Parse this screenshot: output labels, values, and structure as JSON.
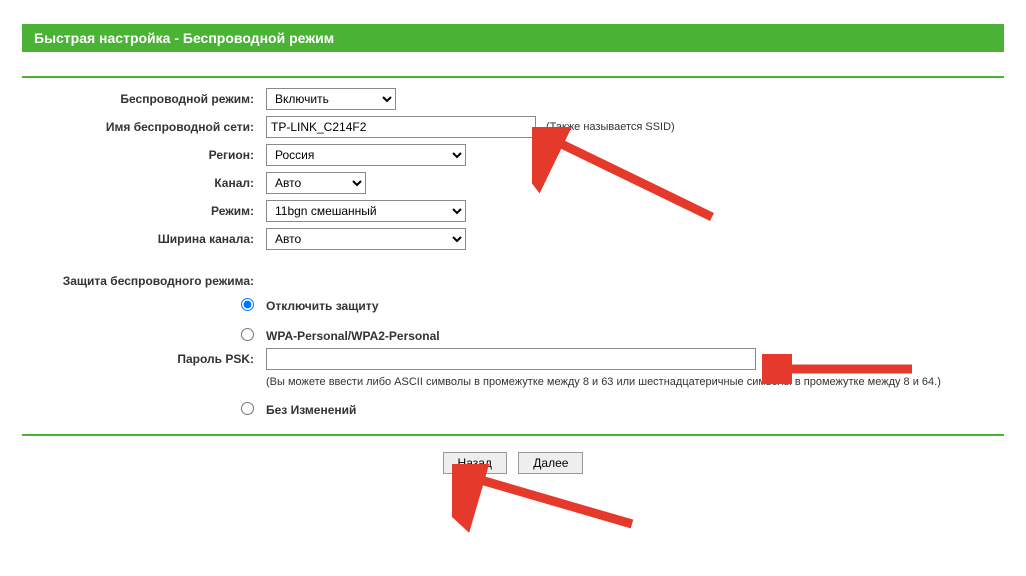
{
  "title": "Быстрая настройка - Беспроводной режим",
  "labels": {
    "wireless_mode": "Беспроводной режим:",
    "ssid": "Имя беспроводной сети:",
    "region": "Регион:",
    "channel": "Канал:",
    "mode": "Режим:",
    "channel_width": "Ширина канала:",
    "security": "Защита беспроводного режима:",
    "psk_password": "Пароль PSK:"
  },
  "values": {
    "wireless_mode": "Включить",
    "ssid": "TP-LINK_C214F2",
    "region": "Россия",
    "channel": "Авто",
    "mode": "11bgn смешанный",
    "channel_width": "Авто",
    "psk_password": ""
  },
  "hints": {
    "ssid_suffix": "(Также называется SSID)",
    "psk_note": "(Вы можете ввести либо ASCII символы в промежутке между 8 и 63 или шестнадцатеричные символы в промежутке между 8 и 64.)"
  },
  "security_options": {
    "disable": "Отключить защиту",
    "wpa": "WPA-Personal/WPA2-Personal",
    "nochange": "Без Изменений"
  },
  "buttons": {
    "back": "Назад",
    "next": "Далее"
  }
}
